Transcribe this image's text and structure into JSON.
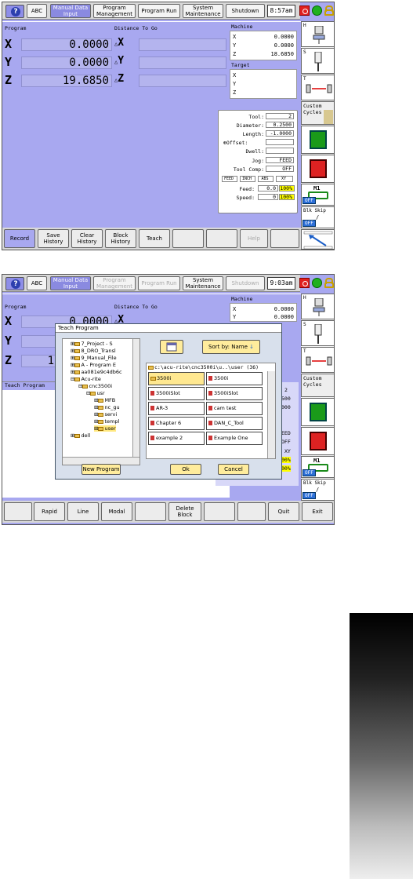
{
  "screen1": {
    "top_buttons": [
      "ABC",
      "Manual Data Input",
      "Program Management",
      "Program Run",
      "System Maintenance",
      "Shutdown"
    ],
    "time": "8:57am",
    "program_label": "Program",
    "dtg_label": "Distance To Go",
    "machine_label": "Machine",
    "target_label": "Target",
    "axes": [
      {
        "name": "X",
        "value": "0.0000"
      },
      {
        "name": "Y",
        "value": "0.0000"
      },
      {
        "name": "Z",
        "value": "19.6850"
      }
    ],
    "dtg_axes": [
      "X",
      "Y",
      "Z"
    ],
    "machine": [
      {
        "axis": "X",
        "value": "0.0000"
      },
      {
        "axis": "Y",
        "value": "0.0000"
      },
      {
        "axis": "Z",
        "value": "18.6850"
      }
    ],
    "target_axes": [
      "X",
      "Y",
      "Z"
    ],
    "status": {
      "tool_label": "Tool:",
      "tool": "2",
      "diameter_label": "Diameter:",
      "diameter": "0.2500",
      "length_label": "Length:",
      "length": "-1.0000",
      "offset_label": "Offset:",
      "dwell_label": "Dwell:",
      "jog_label": "Jog:",
      "jog": "FEED",
      "toolcomp_label": "Tool Comp:",
      "toolcomp": "OFF",
      "modes": [
        "FEED",
        "INCH",
        "ABS",
        "XY"
      ],
      "feed_label": "Feed:",
      "feed": "0.0",
      "feed_pct": "100%",
      "speed_label": "Speed:",
      "speed": "0",
      "speed_pct": "100%"
    },
    "right": {
      "h": "H",
      "s": "S",
      "t": "T",
      "custom": "Custom Cycles",
      "m1": "M1",
      "off": "OFF",
      "blk": "Blk Skip",
      "slash": "/",
      "off2": "OFF"
    },
    "bottom_buttons": [
      "Record",
      "Save History",
      "Clear History",
      "Block History",
      "Teach",
      "",
      "",
      "Help",
      ""
    ]
  },
  "screen2": {
    "top_buttons": [
      "ABC",
      "Manual Data Input",
      "Program Management",
      "Program Run",
      "System Maintenance",
      "Shutdown"
    ],
    "time": "9:03am",
    "program_label": "Program",
    "dtg_label": "Distance To Go",
    "machine_label": "Machine",
    "axes": [
      "X",
      "Y",
      "Z"
    ],
    "x_value": "0.0000",
    "partial_z": "1",
    "machine": [
      {
        "axis": "X",
        "value": "0.0000"
      },
      {
        "axis": "Y",
        "value": "0.0000"
      }
    ],
    "teach_program_label": "Teach Program",
    "dialog": {
      "title": "Teach Program",
      "tree": [
        "7_Project - S",
        "8_DRO_Transl",
        "9_Manual_File",
        "A - Program E",
        "aa081e9c4db6c",
        "Acu-rite",
        "cnc3500i",
        "usr",
        "MFB",
        "nc_gu",
        "servi",
        "templ",
        "user",
        "dell"
      ],
      "sort": "Sort by: Name",
      "path": "c:\\acu-rite\\cnc3500i\\u..\\user (36)",
      "files": [
        [
          "3500i",
          "3500i"
        ],
        [
          "3500iSlot",
          "3500iSlot"
        ],
        [
          "AR-3",
          "cam test"
        ],
        [
          "Chapter 6",
          "DAN_C_Tool"
        ],
        [
          "example 2",
          "Example One"
        ]
      ],
      "new_program": "New Program",
      "ok": "Ok",
      "cancel": "Cancel"
    },
    "bg_status": [
      "2",
      "500",
      "000",
      "EED",
      "OFF",
      "XY",
      "00%",
      "00%"
    ],
    "right": {
      "h": "H",
      "s": "S",
      "t": "T",
      "custom": "Custom Cycles",
      "m1": "M1",
      "off": "OFF",
      "blk": "Blk Skip",
      "slash": "/",
      "off2": "OFF"
    },
    "bottom_buttons": [
      "",
      "Rapid",
      "Line",
      "Modal",
      "",
      "Delete Block",
      "",
      "",
      "Quit",
      "Exit"
    ]
  }
}
